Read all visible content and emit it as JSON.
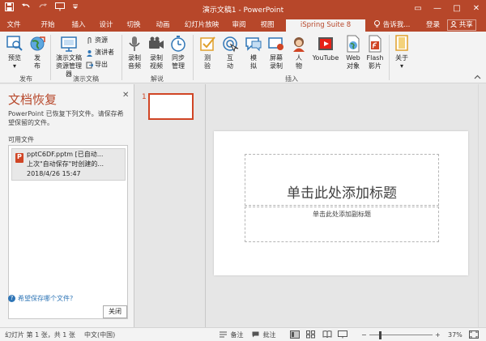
{
  "window": {
    "title": "演示文稿1 - PowerPoint",
    "controls": [
      "▭",
      "—",
      "□",
      "✕"
    ]
  },
  "qat": {
    "save_icon": "save-icon",
    "undo_icon": "undo-icon",
    "redo_icon": "redo-icon",
    "present_icon": "present-icon",
    "customize_icon": "customize-icon"
  },
  "tabs": [
    {
      "label": "文件"
    },
    {
      "label": "开始"
    },
    {
      "label": "插入"
    },
    {
      "label": "设计"
    },
    {
      "label": "切换"
    },
    {
      "label": "动画"
    },
    {
      "label": "幻灯片放映"
    },
    {
      "label": "审阅"
    },
    {
      "label": "视图"
    },
    {
      "label": "iSpring Suite 8"
    }
  ],
  "tell_me": "告诉我...",
  "login": "登录",
  "share": "共享",
  "ribbon": {
    "buttons": [
      {
        "label1": "预览",
        "label2": "▾"
      },
      {
        "label1": "发",
        "label2": "布"
      },
      {
        "label1": "演示文稿",
        "label2": "资源管理器"
      },
      {
        "label1": "录制",
        "label2": "音频"
      },
      {
        "label1": "录制",
        "label2": "视频"
      },
      {
        "label1": "同步",
        "label2": "管理"
      },
      {
        "label1": "测",
        "label2": "验"
      },
      {
        "label1": "互",
        "label2": "动"
      },
      {
        "label1": "模",
        "label2": "拟"
      },
      {
        "label1": "屏幕",
        "label2": "录制"
      },
      {
        "label1": "人",
        "label2": "物"
      },
      {
        "label1": "YouTube",
        "label2": ""
      },
      {
        "label1": "Web",
        "label2": "对象"
      },
      {
        "label1": "Flash",
        "label2": "影片"
      },
      {
        "label1": "关于",
        "label2": "▾"
      }
    ],
    "small_items": [
      {
        "label": "资源"
      },
      {
        "label": "演讲者"
      },
      {
        "label": "导出"
      }
    ],
    "groups": [
      {
        "label": "发布"
      },
      {
        "label": "演示文稿"
      },
      {
        "label": "解说"
      },
      {
        "label": "插入"
      }
    ]
  },
  "recovery": {
    "title": "文档恢复",
    "close": "✕",
    "description": "PowerPoint 已恢复下列文件。请保存希望保留的文件。",
    "available": "可用文件",
    "file": {
      "name": "pptC6DF.pptm  [已自动...",
      "desc": "上次\"自动保存\"时创建的...",
      "time": "2018/4/26 15:47"
    },
    "help": "希望保存哪个文件?",
    "close_button": "关闭"
  },
  "thumbs": {
    "number": "1"
  },
  "slide": {
    "title_placeholder": "单击此处添加标题",
    "subtitle_placeholder": "单击此处添加副标题"
  },
  "status": {
    "slide_info": "幻灯片 第 1 张，共 1 张",
    "language": "中文(中国)",
    "notes": "备注",
    "comments": "批注",
    "zoom": "37%",
    "zoom_fraction": 0.37
  },
  "colors": {
    "accent": "#b7472a",
    "accent_light": "#d04525"
  }
}
